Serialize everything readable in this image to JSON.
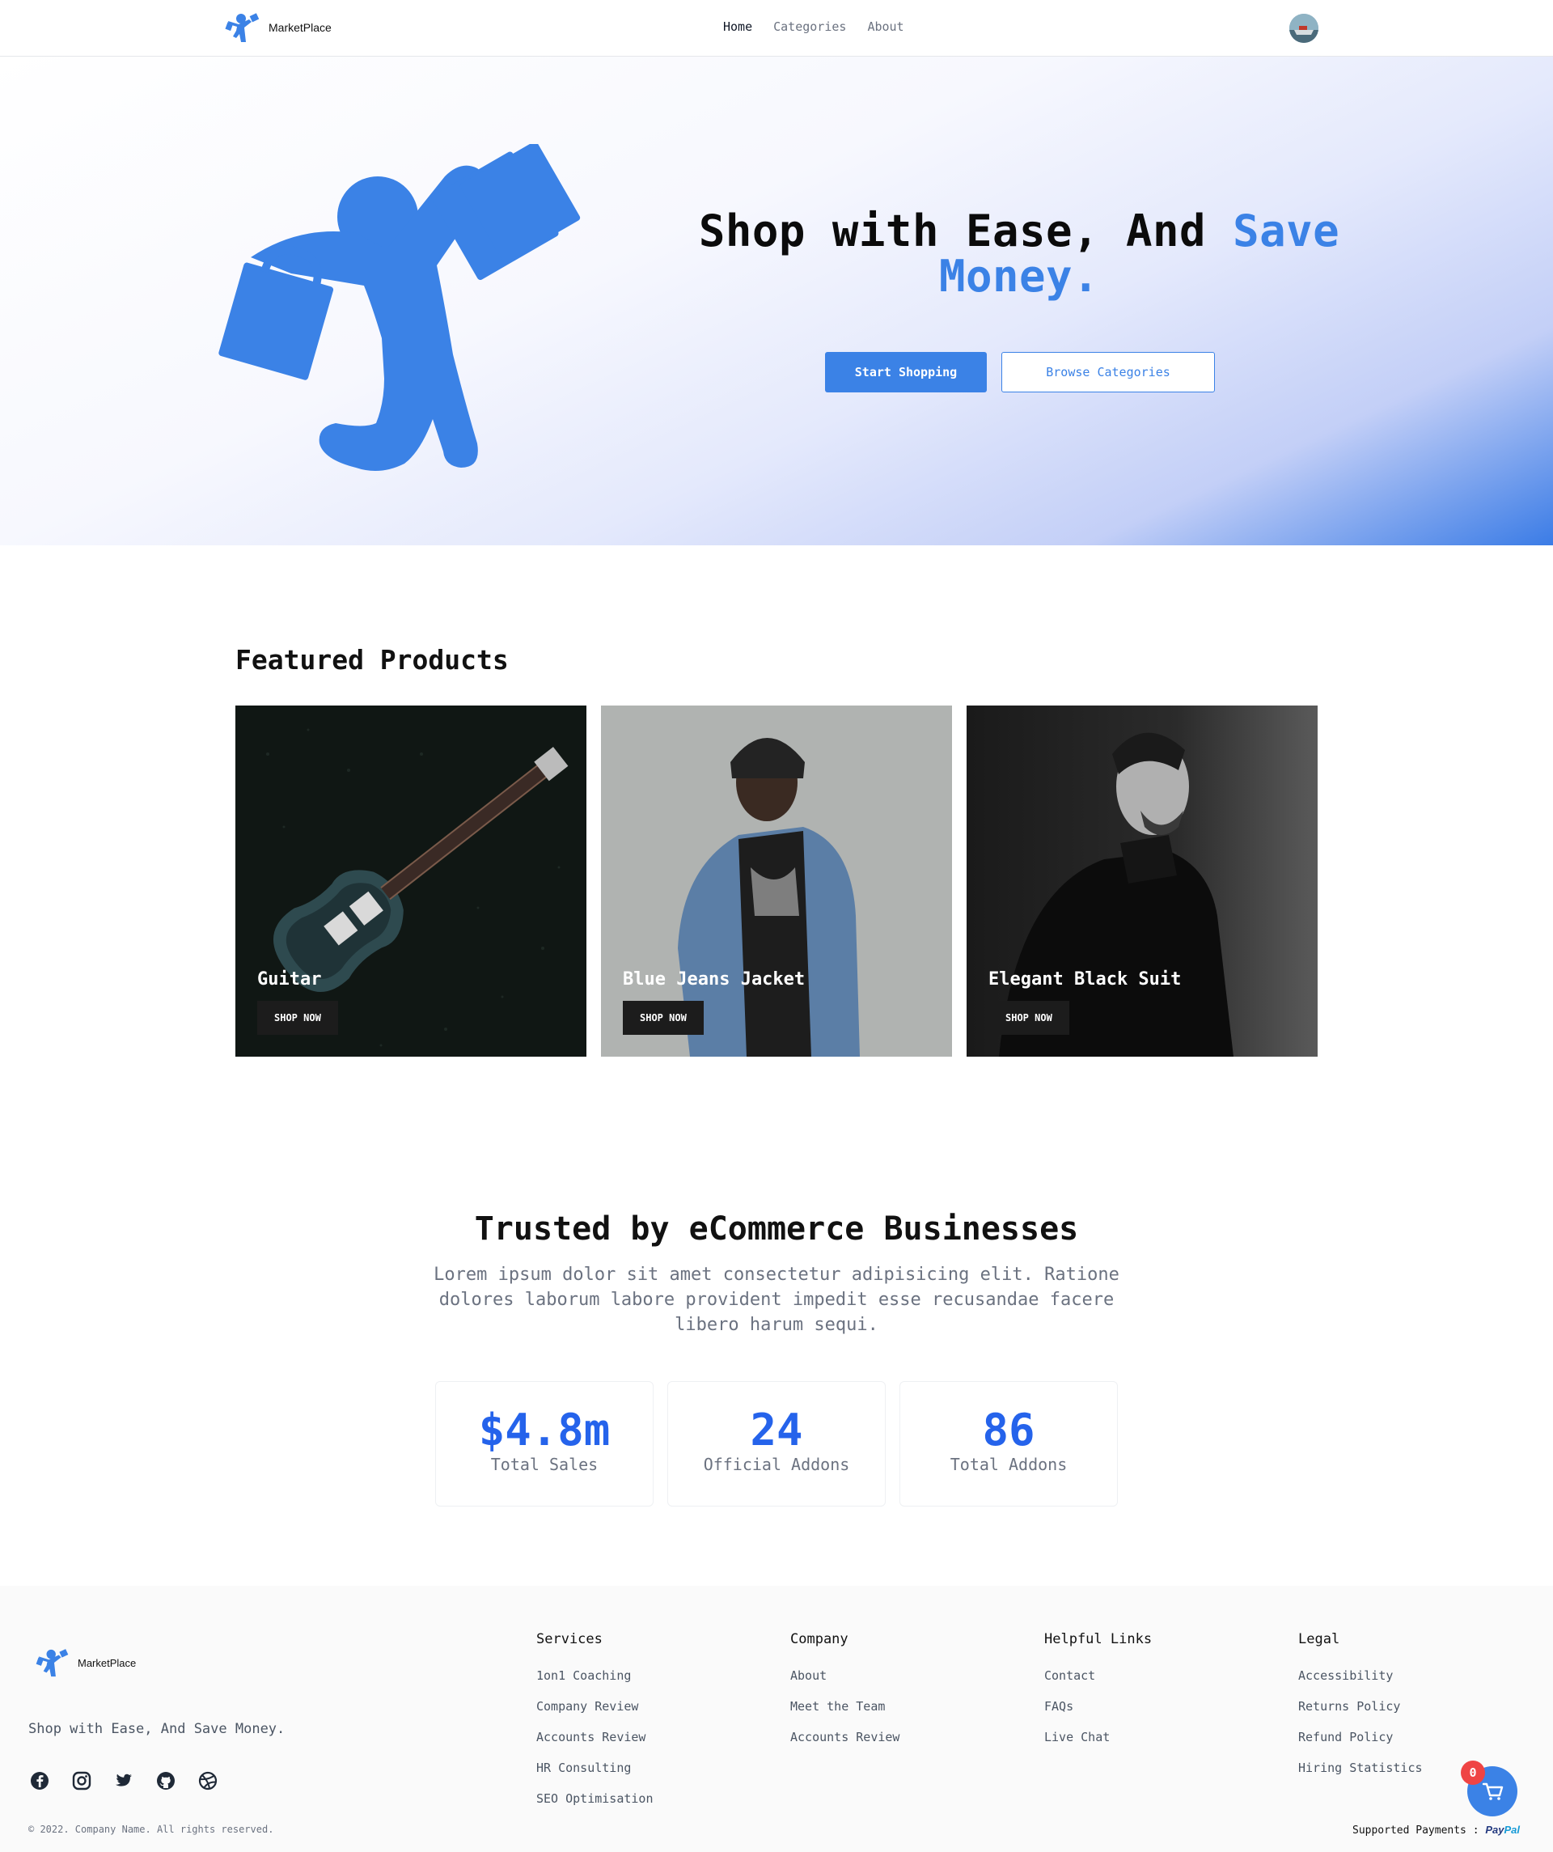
{
  "app": {
    "name": "MarketPlace"
  },
  "nav": {
    "links": [
      {
        "label": "Home",
        "active": true
      },
      {
        "label": "Categories",
        "active": false
      },
      {
        "label": "About",
        "active": false
      }
    ]
  },
  "hero": {
    "title_part1": "Shop with Ease, And",
    "title_accent": "Save Money.",
    "primary_button": "Start Shopping",
    "secondary_button": "Browse Categories",
    "accent_color": "#3b82e6"
  },
  "featured": {
    "title": "Featured Products",
    "products": [
      {
        "name": "Guitar",
        "button": "SHOP NOW"
      },
      {
        "name": "Blue Jeans Jacket",
        "button": "SHOP NOW"
      },
      {
        "name": "Elegant Black Suit",
        "button": "SHOP NOW"
      }
    ]
  },
  "trusted": {
    "title": "Trusted by eCommerce Businesses",
    "text": "Lorem ipsum dolor sit amet consectetur adipisicing elit. Ratione dolores laborum labore provident impedit esse recusandae facere libero harum sequi.",
    "stats": [
      {
        "value": "$4.8m",
        "label": "Total Sales"
      },
      {
        "value": "24",
        "label": "Official Addons"
      },
      {
        "value": "86",
        "label": "Total Addons"
      }
    ]
  },
  "footer": {
    "tagline": "Shop with Ease, And Save Money.",
    "socials": [
      "facebook-icon",
      "instagram-icon",
      "twitter-icon",
      "github-icon",
      "dribbble-icon"
    ],
    "columns": [
      {
        "title": "Services",
        "items": [
          "1on1 Coaching",
          "Company Review",
          "Accounts Review",
          "HR Consulting",
          "SEO Optimisation"
        ]
      },
      {
        "title": "Company",
        "items": [
          "About",
          "Meet the Team",
          "Accounts Review"
        ]
      },
      {
        "title": "Helpful Links",
        "items": [
          "Contact",
          "FAQs",
          "Live Chat"
        ]
      },
      {
        "title": "Legal",
        "items": [
          "Accessibility",
          "Returns Policy",
          "Refund Policy",
          "Hiring Statistics"
        ]
      }
    ],
    "copyright": "© 2022. Company Name. All rights reserved.",
    "payments_label": "Supported Payments :",
    "paypal_part1": "Pay",
    "paypal_part2": "Pal",
    "cart_count": "0"
  }
}
